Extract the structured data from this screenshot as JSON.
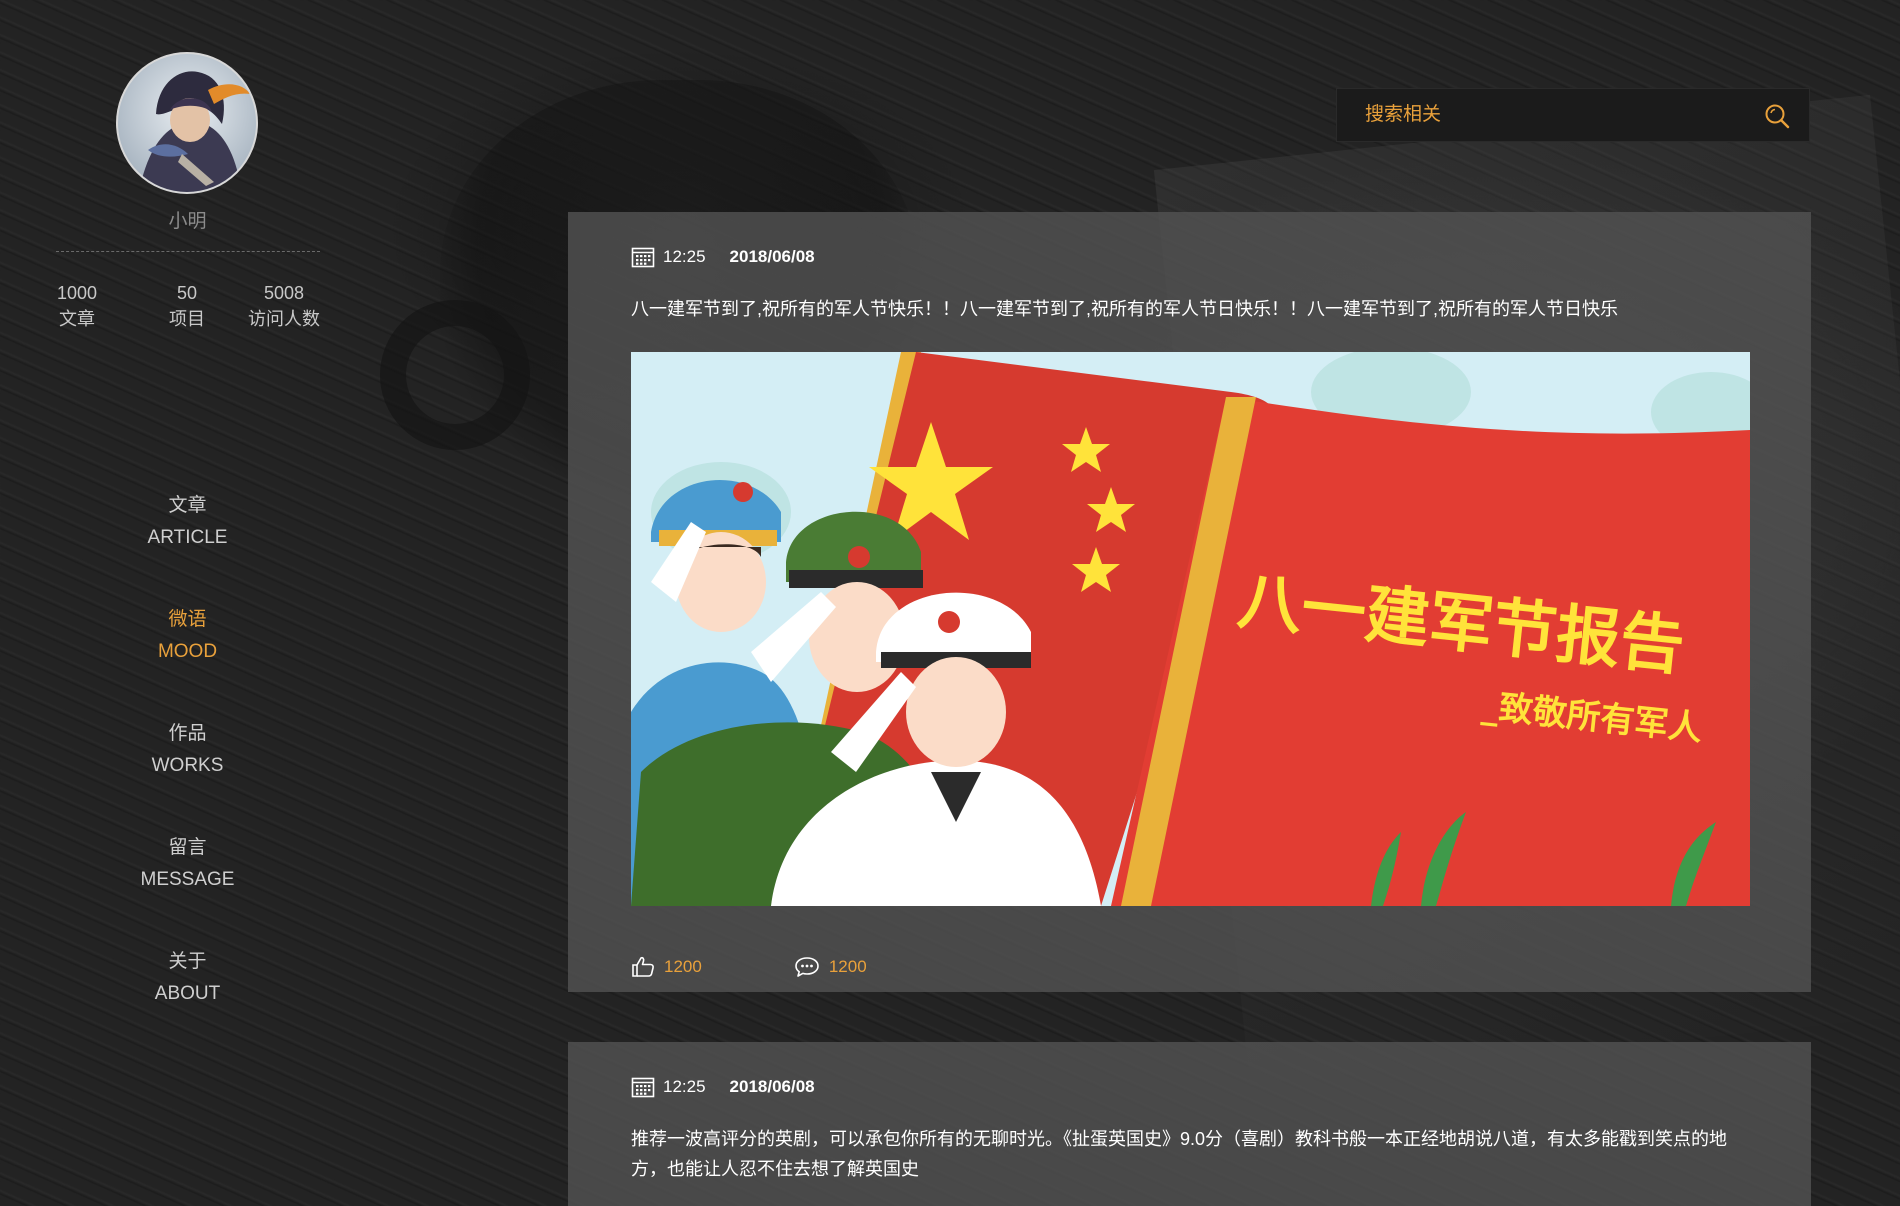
{
  "colors": {
    "accent": "#e9a13b",
    "panel": "#525252",
    "text": "#ffffff",
    "muted": "#8b8b8b"
  },
  "profile": {
    "name": "小明",
    "stats": [
      {
        "value": "1000",
        "label": "文章"
      },
      {
        "value": "50",
        "label": "项目"
      },
      {
        "value": "5008",
        "label": "访问人数"
      }
    ]
  },
  "nav": [
    {
      "cn": "文章",
      "en": "ARTICLE",
      "active": false
    },
    {
      "cn": "微语",
      "en": "MOOD",
      "active": true
    },
    {
      "cn": "作品",
      "en": "WORKS",
      "active": false
    },
    {
      "cn": "留言",
      "en": "MESSAGE",
      "active": false
    },
    {
      "cn": "关于",
      "en": "ABOUT",
      "active": false
    }
  ],
  "search": {
    "placeholder": "搜索相关",
    "icon": "search-icon"
  },
  "posts": [
    {
      "time": "12:25",
      "date": "2018/06/08",
      "text": "八一建军节到了,祝所有的军人节快乐！！八一建军节到了,祝所有的军人节日快乐！！八一建军节到了,祝所有的军人节日快乐",
      "image": {
        "title": "八一建军节报告",
        "subtitle": "_致敬所有军人"
      },
      "likes": "1200",
      "comments": "1200"
    },
    {
      "time": "12:25",
      "date": "2018/06/08",
      "text": "推荐一波高评分的英剧，可以承包你所有的无聊时光。《扯蛋英国史》9.0分（喜剧）教科书般一本正经地胡说八道，有太多能戳到笑点的地方，也能让人忍不住去想了解英国史"
    }
  ]
}
